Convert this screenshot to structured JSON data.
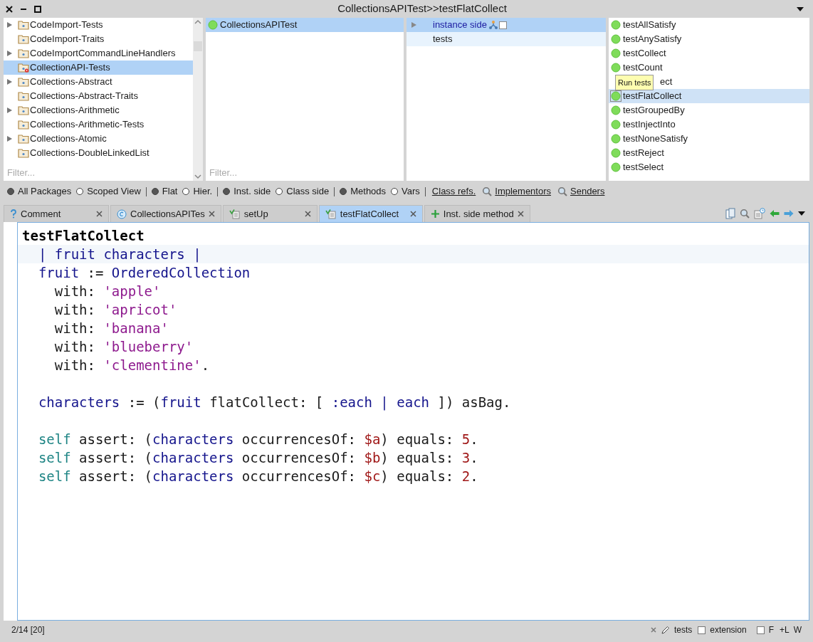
{
  "window": {
    "title": "CollectionsAPITest>>testFlatCollect"
  },
  "packages": {
    "items": [
      {
        "label": "CodeImport-Tests",
        "expandable": true,
        "selected": false,
        "badge": false
      },
      {
        "label": "CodeImport-Traits",
        "expandable": false,
        "selected": false,
        "badge": false
      },
      {
        "label": "CodeImportCommandLineHandlers",
        "expandable": true,
        "selected": false,
        "badge": false
      },
      {
        "label": "CollectionAPI-Tests",
        "expandable": false,
        "selected": true,
        "badge": true
      },
      {
        "label": "Collections-Abstract",
        "expandable": true,
        "selected": false,
        "badge": false
      },
      {
        "label": "Collections-Abstract-Traits",
        "expandable": false,
        "selected": false,
        "badge": false
      },
      {
        "label": "Collections-Arithmetic",
        "expandable": true,
        "selected": false,
        "badge": false
      },
      {
        "label": "Collections-Arithmetic-Tests",
        "expandable": false,
        "selected": false,
        "badge": false
      },
      {
        "label": "Collections-Atomic",
        "expandable": true,
        "selected": false,
        "badge": false
      },
      {
        "label": "Collections-DoubleLinkedList",
        "expandable": false,
        "selected": false,
        "badge": false
      }
    ],
    "filter_placeholder": "Filter..."
  },
  "classes": {
    "items": [
      {
        "label": "CollectionsAPITest",
        "selected": true
      }
    ],
    "filter_placeholder": "Filter..."
  },
  "protocols": {
    "items": [
      {
        "label": "instance side",
        "selected": true,
        "kind": "all"
      },
      {
        "label": "tests",
        "selected": false,
        "hovered": true,
        "kind": "protocol"
      }
    ]
  },
  "methods": {
    "items": [
      {
        "label": "testAllSatisfy",
        "selected": false
      },
      {
        "label": "testAnySatisfy",
        "selected": false
      },
      {
        "label": "testCollect",
        "selected": false
      },
      {
        "label": "testCount",
        "selected": false
      },
      {
        "label": "ect",
        "selected": false,
        "covered": true
      },
      {
        "label": "testFlatCollect",
        "selected": true
      },
      {
        "label": "testGroupedBy",
        "selected": false
      },
      {
        "label": "testInjectInto",
        "selected": false
      },
      {
        "label": "testNoneSatisfy",
        "selected": false
      },
      {
        "label": "testReject",
        "selected": false
      },
      {
        "label": "testSelect",
        "selected": false
      }
    ],
    "tooltip": "Run tests"
  },
  "toolbar": {
    "radio_groups": [
      [
        {
          "label": "All Packages",
          "checked": true
        },
        {
          "label": "Scoped View",
          "checked": false
        }
      ],
      [
        {
          "label": "Flat",
          "checked": true
        },
        {
          "label": "Hier.",
          "checked": false
        }
      ],
      [
        {
          "label": "Inst. side",
          "checked": true
        },
        {
          "label": "Class side",
          "checked": false
        }
      ],
      [
        {
          "label": "Methods",
          "checked": true
        },
        {
          "label": "Vars",
          "checked": false
        }
      ]
    ],
    "links": [
      {
        "label": "Class refs.",
        "kind": "plain"
      },
      {
        "label": "Implementors",
        "kind": "search"
      },
      {
        "label": "Senders",
        "kind": "search"
      }
    ]
  },
  "tabs": [
    {
      "label": "Comment",
      "kind": "comment",
      "selected": false
    },
    {
      "label": "CollectionsAPITes",
      "kind": "class",
      "selected": false
    },
    {
      "label": "setUp",
      "kind": "method",
      "selected": false
    },
    {
      "label": "testFlatCollect",
      "kind": "method",
      "selected": true
    },
    {
      "label": "Inst. side method",
      "kind": "new",
      "selected": false
    }
  ],
  "editor": {
    "lines": [
      {
        "current": false,
        "tokens": [
          {
            "text": "testFlatCollect",
            "kind": "header"
          }
        ]
      },
      {
        "current": true,
        "tokens": [
          {
            "text": "  | fruit characters |",
            "kind": "variable"
          }
        ]
      },
      {
        "current": false,
        "tokens": [
          {
            "text": "  fruit",
            "kind": "variable"
          },
          {
            "text": " := ",
            "kind": "plain"
          },
          {
            "text": "OrderedCollection",
            "kind": "variable"
          }
        ]
      },
      {
        "current": false,
        "tokens": [
          {
            "text": "    with: ",
            "kind": "plain"
          },
          {
            "text": "'apple'",
            "kind": "string"
          }
        ]
      },
      {
        "current": false,
        "tokens": [
          {
            "text": "    with: ",
            "kind": "plain"
          },
          {
            "text": "'apricot'",
            "kind": "string"
          }
        ]
      },
      {
        "current": false,
        "tokens": [
          {
            "text": "    with: ",
            "kind": "plain"
          },
          {
            "text": "'banana'",
            "kind": "string"
          }
        ]
      },
      {
        "current": false,
        "tokens": [
          {
            "text": "    with: ",
            "kind": "plain"
          },
          {
            "text": "'blueberry'",
            "kind": "string"
          }
        ]
      },
      {
        "current": false,
        "tokens": [
          {
            "text": "    with: ",
            "kind": "plain"
          },
          {
            "text": "'clementine'",
            "kind": "string"
          },
          {
            "text": ".",
            "kind": "plain"
          }
        ]
      },
      {
        "current": false
      },
      {
        "current": false,
        "tokens": [
          {
            "text": "  characters",
            "kind": "variable"
          },
          {
            "text": " := (",
            "kind": "plain"
          },
          {
            "text": "fruit",
            "kind": "variable"
          },
          {
            "text": " flatCollect: [ ",
            "kind": "plain"
          },
          {
            "text": ":each",
            "kind": "variable"
          },
          {
            "text": " | ",
            "kind": "variable"
          },
          {
            "text": "each",
            "kind": "variable"
          },
          {
            "text": " ]) asBag.",
            "kind": "plain"
          }
        ]
      },
      {
        "current": false
      },
      {
        "current": false,
        "tokens": [
          {
            "text": "  self",
            "kind": "self"
          },
          {
            "text": " assert: (",
            "kind": "plain"
          },
          {
            "text": "characters",
            "kind": "variable"
          },
          {
            "text": " occurrencesOf: ",
            "kind": "plain"
          },
          {
            "text": "$a",
            "kind": "literal"
          },
          {
            "text": ") equals: ",
            "kind": "plain"
          },
          {
            "text": "5",
            "kind": "literal"
          },
          {
            "text": ".",
            "kind": "plain"
          }
        ]
      },
      {
        "current": false,
        "tokens": [
          {
            "text": "  self",
            "kind": "self"
          },
          {
            "text": " assert: (",
            "kind": "plain"
          },
          {
            "text": "characters",
            "kind": "variable"
          },
          {
            "text": " occurrencesOf: ",
            "kind": "plain"
          },
          {
            "text": "$b",
            "kind": "literal"
          },
          {
            "text": ") equals: ",
            "kind": "plain"
          },
          {
            "text": "3",
            "kind": "literal"
          },
          {
            "text": ".",
            "kind": "plain"
          }
        ]
      },
      {
        "current": false,
        "tokens": [
          {
            "text": "  self",
            "kind": "self"
          },
          {
            "text": " assert: (",
            "kind": "plain"
          },
          {
            "text": "characters",
            "kind": "variable"
          },
          {
            "text": " occurrencesOf: ",
            "kind": "plain"
          },
          {
            "text": "$c",
            "kind": "literal"
          },
          {
            "text": ") equals: ",
            "kind": "plain"
          },
          {
            "text": "2",
            "kind": "literal"
          },
          {
            "text": ".",
            "kind": "plain"
          }
        ]
      }
    ]
  },
  "status_bar": {
    "position": "2/14 [20]",
    "protocol": "tests",
    "extension": {
      "label": "extension",
      "checked": false
    },
    "format": {
      "label": "F",
      "checked": false
    },
    "flags": [
      "+L",
      "W"
    ]
  }
}
